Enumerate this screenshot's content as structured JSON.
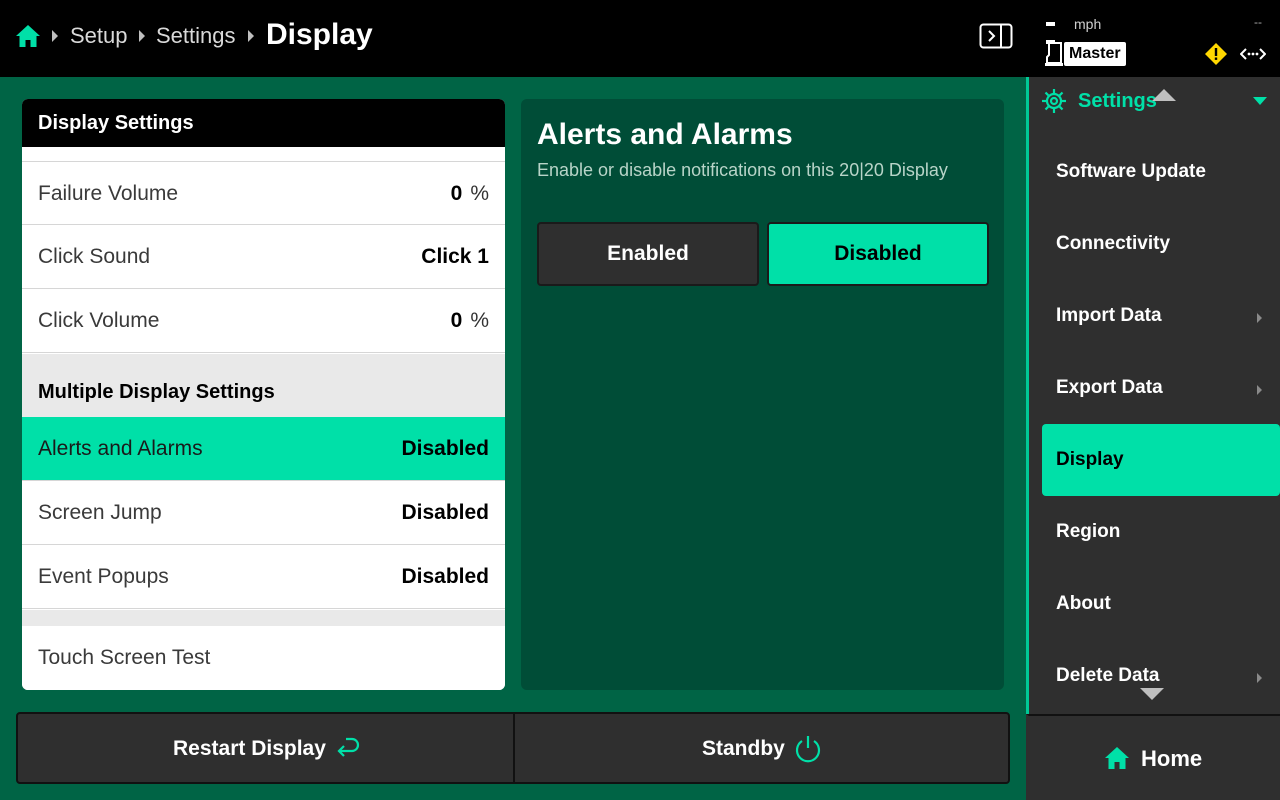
{
  "breadcrumb": {
    "items": [
      "Setup",
      "Settings"
    ],
    "current": "Display"
  },
  "status": {
    "speed_value": "--",
    "speed_unit": "mph",
    "speed_right": "--",
    "role_badge": "Master"
  },
  "icons": {
    "home": "home-icon",
    "panel_toggle": "panel-toggle-icon",
    "warning": "warning-icon",
    "link": "connection-icon",
    "gear": "gear-icon",
    "restart": "restart-icon",
    "power": "power-icon"
  },
  "colors": {
    "background": "#006445",
    "accent": "#00e0a8",
    "detail_panel": "#004d37",
    "warning": "#ffd700"
  },
  "display_settings": {
    "header": "Display Settings",
    "rows": [
      {
        "label": "Failure Volume",
        "value": "0",
        "unit": "%"
      },
      {
        "label": "Click Sound",
        "value": "Click 1",
        "unit": ""
      },
      {
        "label": "Click Volume",
        "value": "0",
        "unit": "%"
      }
    ],
    "multi_section_title": "Multiple Display Settings",
    "multi_rows": [
      {
        "label": "Alerts and Alarms",
        "value": "Disabled"
      },
      {
        "label": "Screen Jump",
        "value": "Disabled"
      },
      {
        "label": "Event Popups",
        "value": "Disabled"
      }
    ],
    "touch_test": "Touch Screen Test"
  },
  "detail": {
    "title": "Alerts and Alarms",
    "description": "Enable or disable notifications on this 20|20 Display",
    "options": [
      "Enabled",
      "Disabled"
    ],
    "selected": "Disabled"
  },
  "bottom": {
    "restart_label": "Restart Display",
    "standby_label": "Standby"
  },
  "sidebar": {
    "header": "Settings",
    "items": [
      {
        "label": "Software Update",
        "submenu": false
      },
      {
        "label": "Connectivity",
        "submenu": false
      },
      {
        "label": "Import Data",
        "submenu": true
      },
      {
        "label": "Export Data",
        "submenu": true
      },
      {
        "label": "Display",
        "submenu": false,
        "active": true
      },
      {
        "label": "Region",
        "submenu": false
      },
      {
        "label": "About",
        "submenu": false
      },
      {
        "label": "Delete Data",
        "submenu": true
      }
    ],
    "home_label": "Home"
  }
}
